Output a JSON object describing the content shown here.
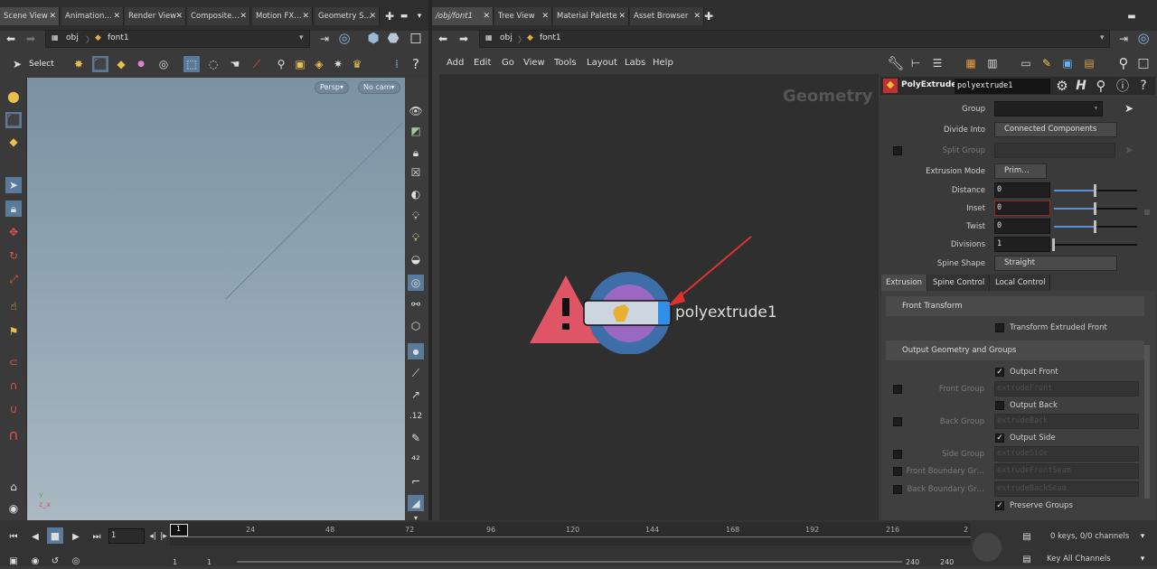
{
  "left_tabs": [
    {
      "label": "Scene View",
      "active": true
    },
    {
      "label": "Animation…"
    },
    {
      "label": "Render View"
    },
    {
      "label": "Composite…"
    },
    {
      "label": "Motion FX…"
    },
    {
      "label": "Geometry S…"
    }
  ],
  "right_tabs": [
    {
      "label": "/obj/font1",
      "active": true
    },
    {
      "label": "Tree View"
    },
    {
      "label": "Material Palette"
    },
    {
      "label": "Asset Browser"
    }
  ],
  "left_path": {
    "context": "obj",
    "node": "font1"
  },
  "right_path": {
    "context": "obj",
    "node": "font1"
  },
  "viewport": {
    "select_label": "Select",
    "camera_persp": "Persp▾",
    "camera_nocam": "No cam▾",
    "axis_y": "y",
    "axis_zx": "z_x"
  },
  "menu": [
    "Add",
    "Edit",
    "Go",
    "View",
    "Tools",
    "Layout",
    "Labs",
    "Help"
  ],
  "network": {
    "context_label": "Geometry",
    "node_name": "polyextrude1"
  },
  "params": {
    "node_type": "PolyExtrude",
    "node_name": "polyextrude1",
    "group_label": "Group",
    "divide_into_label": "Divide Into",
    "divide_into_value": "Connected Components",
    "split_group_label": "Split Group",
    "extrusion_mode_label": "Extrusion Mode",
    "extrusion_mode_value": "Prim…",
    "distance_label": "Distance",
    "distance_value": "0",
    "inset_label": "Inset",
    "inset_value": "0",
    "twist_label": "Twist",
    "twist_value": "0",
    "divisions_label": "Divisions",
    "divisions_value": "1",
    "spine_shape_label": "Spine Shape",
    "spine_shape_value": "Straight",
    "tabs": [
      "Extrusion",
      "Spine Control",
      "Local Control"
    ],
    "front_transform": "Front Transform",
    "transform_extruded_front": "Transform Extruded Front",
    "output_section": "Output Geometry and Groups",
    "output_front": "Output Front",
    "front_group_label": "Front Group",
    "front_group_value": "extrudeFront",
    "output_back": "Output Back",
    "back_group_label": "Back Group",
    "back_group_value": "extrudeBack",
    "output_side": "Output Side",
    "side_group_label": "Side Group",
    "side_group_value": "extrudeSide",
    "front_boundary_label": "Front Boundary Gr…",
    "front_boundary_value": "extrudeFrontSeam",
    "back_boundary_label": "Back Boundary Gr…",
    "back_boundary_value": "extrudeBackSeam",
    "preserve_groups": "Preserve Groups"
  },
  "timeline": {
    "ticks": [
      "1",
      "24",
      "48",
      "72",
      "96",
      "120",
      "144",
      "168",
      "192",
      "216",
      "2"
    ],
    "current_frame": "1",
    "range_start": "1",
    "range_start2": "1",
    "range_end": "240",
    "range_end2": "240",
    "keys_label": "0 keys, 0/0 channels",
    "key_all": "Key All Channels"
  }
}
